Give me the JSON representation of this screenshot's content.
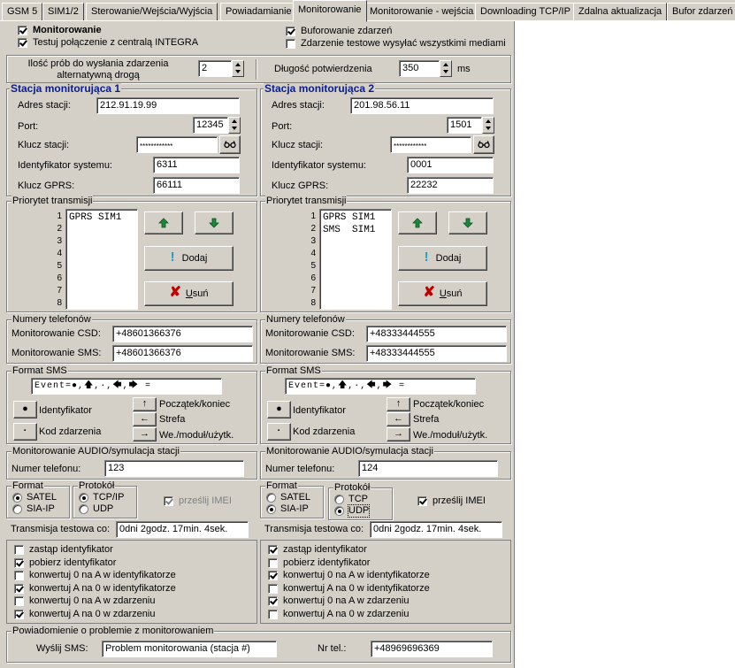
{
  "tabs": [
    "GSM 5",
    "SIM1/2",
    "Sterowanie/Wejścia/Wyjścia",
    "Powiadamianie",
    "Monitorowanie",
    "Monitorowanie - wejścia",
    "Downloading TCP/IP",
    "Zdalna aktualizacja",
    "Bufor zdarzeń"
  ],
  "top": {
    "monitorowanie": "Monitorowanie",
    "testuj": "Testuj połączenie z centralą INTEGRA",
    "buforowanie": "Buforowanie zdarzeń",
    "zdarzenie_testowe": "Zdarzenie testowe wysyłać wszystkimi mediami"
  },
  "proby": {
    "label_line1": "Ilość prób do wysłania zdarzenia",
    "label_line2": "alternatywną drogą",
    "value": "2",
    "dlugosc_label": "Długość potwierdzenia",
    "dlugosc_value": "350",
    "unit": "ms"
  },
  "labels": {
    "adres": "Adres stacji:",
    "port": "Port:",
    "klucz": "Klucz stacji:",
    "identyfikator": "Identyfikator systemu:",
    "gprs": "Klucz GPRS:",
    "priorytet": "Priorytet transmisji",
    "dodaj": "Dodaj",
    "usun_u": "U",
    "usun_rest": "suń",
    "numery": "Numery telefonów",
    "csd": "Monitorowanie CSD:",
    "sms": "Monitorowanie SMS:",
    "format_sms": "Format SMS",
    "identyfikator_btn": "Identyfikator",
    "kod": "Kod zdarzenia",
    "poczatek": "Początek/koniec",
    "strefa": "Strefa",
    "wemodul": "We./moduł/użytk.",
    "audio": "Monitorowanie AUDIO/symulacja stacji",
    "numer_tel": "Numer telefonu:",
    "format": "Format",
    "satel": "SATEL",
    "siaip": "SIA-IP",
    "protokol": "Protokół",
    "tcpip": "TCP/IP",
    "tcp": "TCP",
    "udp": "UDP",
    "imei": "prześlij IMEI",
    "transmisja": "Transmisja testowa co:",
    "zastap": "zastąp identyfikator",
    "pobierz": "pobierz identyfikator",
    "konw0A_id": "konwertuj 0 na A w identyfikatorze",
    "konwA0_id": "konwertuj A na 0 w identyfikatorze",
    "konw0A_zd": "konwertuj 0 na A w zdarzeniu",
    "konwA0_zd": "konwertuj A na 0 w zdarzeniu"
  },
  "stations": [
    {
      "title": "Stacja monitorująca 1",
      "adres": "212.91.19.99",
      "port": "12345",
      "klucz": "************",
      "identyfikator": "6311",
      "gprs": "66111",
      "priority_lines": [
        "GPRS SIM1",
        "",
        "",
        "",
        "",
        "",
        "",
        ""
      ],
      "csd": "+48601366376",
      "sms": "+48601366376",
      "sms_format": "Event=●,🡅,·,🡄,🡆 =",
      "audio_num": "123",
      "format_selected": "SATEL",
      "protocol_selected": "TCP/IP",
      "imei": true,
      "transmisja": "0dni  2godz. 17min.  4sek.",
      "options": [
        false,
        true,
        false,
        true,
        false,
        true
      ]
    },
    {
      "title": "Stacja monitorująca 2",
      "adres": "201.98.56.11",
      "port": "1501",
      "klucz": "************",
      "identyfikator": "0001",
      "gprs": "22232",
      "priority_lines": [
        "GPRS SIM1",
        "SMS  SIM1",
        "",
        "",
        "",
        "",
        "",
        ""
      ],
      "csd": "+48333444555",
      "sms": "+48333444555",
      "sms_format": "Event=●,🡅,·,🡄,🡆 =",
      "audio_num": "124",
      "format_selected": "SIA-IP",
      "protocol_selected": "UDP",
      "imei": true,
      "transmisja": "0dni  2godz. 17min.  4sek.",
      "options": [
        true,
        false,
        true,
        false,
        true,
        false
      ]
    }
  ],
  "powiadomienie": {
    "title": "Powiadomienie o problemie z monitorowaniem",
    "wyslij_label": "Wyślij SMS:",
    "wyslij_value": "Problem monitorowania (stacja #)",
    "nrtel_label": "Nr tel.:",
    "nrtel_value": "+48969696369"
  },
  "colors": {
    "face": "#d4d0c8",
    "title_blue": "#0a1c8f",
    "up_arrow": "#1a8a3a",
    "remove_x": "#c00000",
    "exclaim": "#18a0c8"
  }
}
